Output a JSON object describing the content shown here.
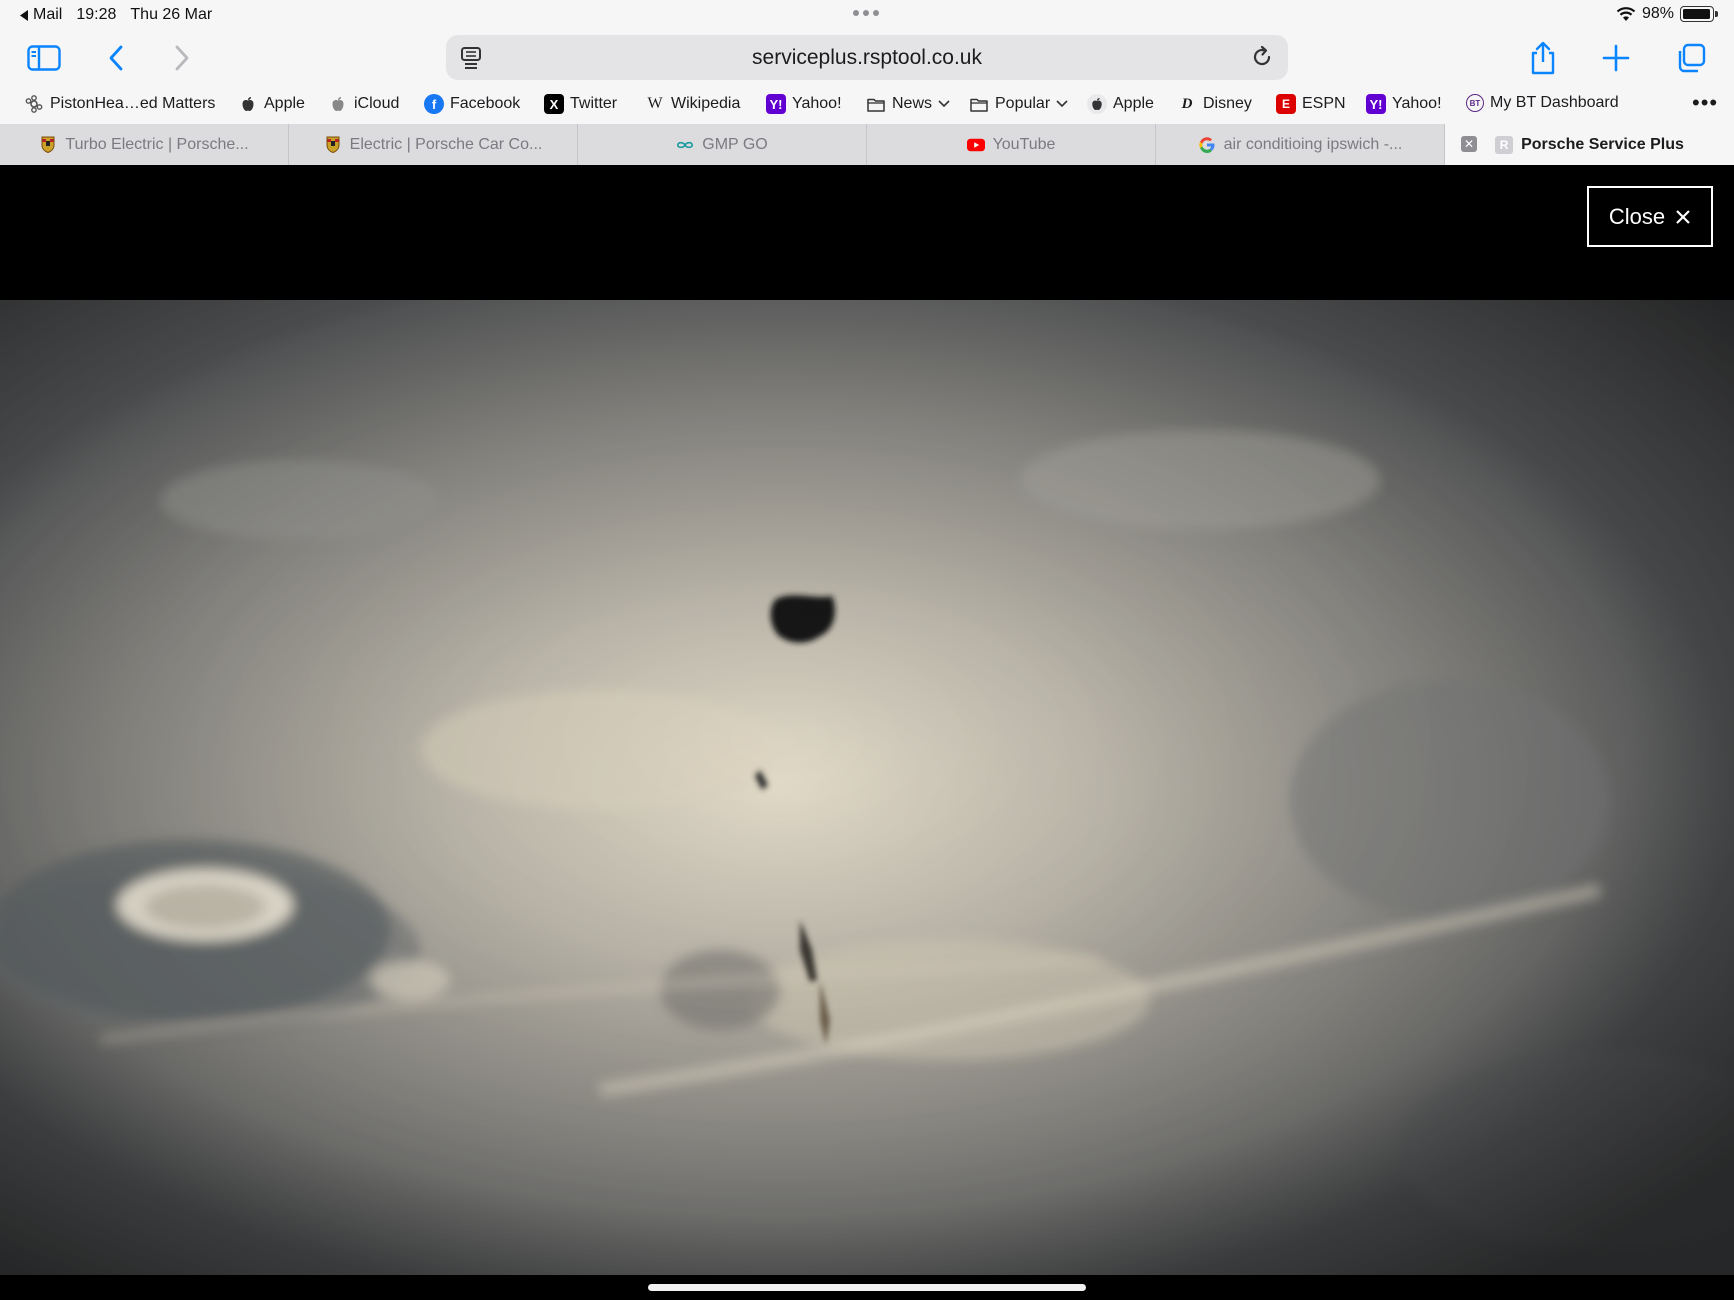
{
  "status_bar": {
    "back_app": "Mail",
    "time": "19:28",
    "date": "Thu 26 Mar",
    "battery": "98%"
  },
  "toolbar": {
    "url": "serviceplus.rsptool.co.uk"
  },
  "favorites": [
    {
      "label": "PistonHea…ed Matters",
      "icon": "gear-icon"
    },
    {
      "label": "Apple",
      "icon": "apple-icon"
    },
    {
      "label": "iCloud",
      "icon": "apple-icon"
    },
    {
      "label": "Facebook",
      "icon": "facebook-icon"
    },
    {
      "label": "Twitter",
      "icon": "x-icon"
    },
    {
      "label": "Wikipedia",
      "icon": "wikipedia-icon"
    },
    {
      "label": "Yahoo!",
      "icon": "yahoo-icon"
    },
    {
      "label": "News",
      "icon": "folder-icon"
    },
    {
      "label": "Popular",
      "icon": "folder-icon"
    },
    {
      "label": "Apple",
      "icon": "apple-icon"
    },
    {
      "label": "Disney",
      "icon": "disney-icon"
    },
    {
      "label": "ESPN",
      "icon": "espn-icon"
    },
    {
      "label": "Yahoo!",
      "icon": "yahoo-icon"
    },
    {
      "label": "My BT Dashboard",
      "icon": "bt-icon"
    }
  ],
  "tabs": [
    {
      "label": "Turbo Electric | Porsche...",
      "icon": "porsche-crest-icon"
    },
    {
      "label": "Electric | Porsche Car Co...",
      "icon": "porsche-crest-icon"
    },
    {
      "label": "GMP GO",
      "icon": "infinity-icon"
    },
    {
      "label": "YouTube",
      "icon": "youtube-icon"
    },
    {
      "label": "air conditioing ipswich -...",
      "icon": "google-icon"
    },
    {
      "label": "Porsche Service Plus",
      "icon": "letter-r-icon",
      "active": true
    }
  ],
  "viewer": {
    "close_label": "Close"
  },
  "colors": {
    "chrome_bg": "#f6f6f7",
    "accent": "#0a84ff",
    "tab_strip_bg": "#dcdcdf",
    "viewer_bg": "#000000"
  }
}
